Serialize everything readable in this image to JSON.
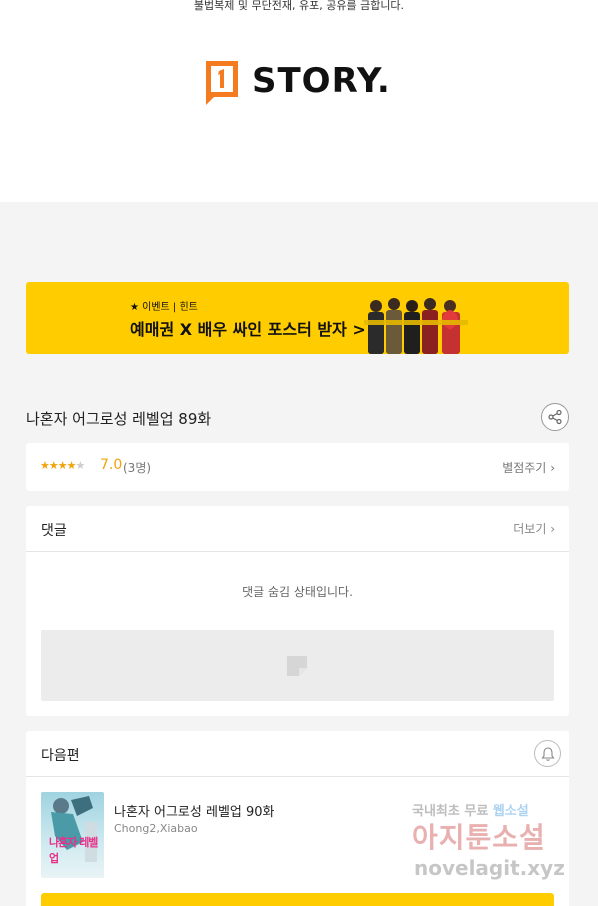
{
  "header": {
    "notice": "불법복제 및 무단전재, 유포, 공유를 금합니다.",
    "logo_text": "STORY."
  },
  "banner": {
    "tag": "★ 이벤트 | 힌트",
    "title": "예매권 X 배우 싸인 포스터 받자 >"
  },
  "episode": {
    "title": "나혼자 어그로성 레벨업 89화"
  },
  "rating": {
    "stars": 3.5,
    "score": "7.0",
    "count": "(3명)",
    "rate_label": "별점주기"
  },
  "comments": {
    "title": "댓글",
    "more_label": "더보기",
    "hidden_message": "댓글 숨김 상태입니다."
  },
  "next": {
    "title": "다음편",
    "episode_title": "나혼자 어그로성 레벨업 90화",
    "author": "Chong2,Xiabao",
    "thumb_text": "나혼자 레벨업"
  },
  "watermark": {
    "line1_a": "국내최초 무료",
    "line1_b": "웹소설",
    "line2": "아지툰소설",
    "line3": "novelagit.xyz"
  },
  "colors": {
    "accent": "#ffcc00",
    "star": "#f0a30a",
    "logo_orange": "#f47b20"
  }
}
